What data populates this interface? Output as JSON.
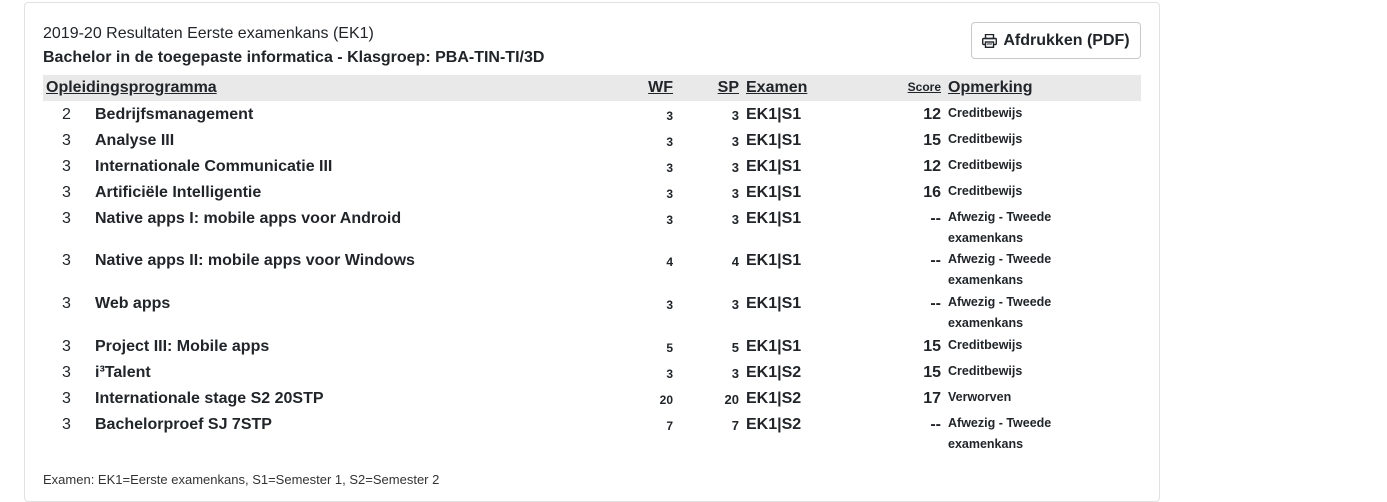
{
  "header": {
    "title": "2019-20 Resultaten Eerste examenkans (EK1)",
    "subtitle": "Bachelor in de toegepaste informatica - Klasgroep: PBA-TIN-TI/3D",
    "print_button": "Afdrukken (PDF)",
    "print_icon": "printer-icon"
  },
  "table": {
    "columns": {
      "program": "Opleidingsprogramma",
      "wf": "WF",
      "sp": "SP",
      "exam": "Examen",
      "score": "Score",
      "remark": "Opmerking"
    },
    "rows": [
      {
        "sem": "2",
        "name": "Bedrijfsmanagement",
        "wf": "3",
        "sp": "3",
        "exam": "EK1|S1",
        "score": "12",
        "remark": "Creditbewijs"
      },
      {
        "sem": "3",
        "name": "Analyse III",
        "wf": "3",
        "sp": "3",
        "exam": "EK1|S1",
        "score": "15",
        "remark": "Creditbewijs"
      },
      {
        "sem": "3",
        "name": "Internationale Communicatie III",
        "wf": "3",
        "sp": "3",
        "exam": "EK1|S1",
        "score": "12",
        "remark": "Creditbewijs"
      },
      {
        "sem": "3",
        "name": "Artificiële Intelligentie",
        "wf": "3",
        "sp": "3",
        "exam": "EK1|S1",
        "score": "16",
        "remark": "Creditbewijs"
      },
      {
        "sem": "3",
        "name": "Native apps I: mobile apps voor Android",
        "wf": "3",
        "sp": "3",
        "exam": "EK1|S1",
        "score": "--",
        "remark": "Afwezig - Tweede examenkans"
      },
      {
        "sem": "3",
        "name": "Native apps II: mobile apps voor Windows",
        "wf": "4",
        "sp": "4",
        "exam": "EK1|S1",
        "score": "--",
        "remark": "Afwezig - Tweede examenkans"
      },
      {
        "sem": "3",
        "name": "Web apps",
        "wf": "3",
        "sp": "3",
        "exam": "EK1|S1",
        "score": "--",
        "remark": "Afwezig - Tweede examenkans"
      },
      {
        "sem": "3",
        "name": "Project III: Mobile apps",
        "wf": "5",
        "sp": "5",
        "exam": "EK1|S1",
        "score": "15",
        "remark": "Creditbewijs"
      },
      {
        "sem": "3",
        "name": "i³Talent",
        "wf": "3",
        "sp": "3",
        "exam": "EK1|S2",
        "score": "15",
        "remark": "Creditbewijs"
      },
      {
        "sem": "3",
        "name": "Internationale stage S2 20STP",
        "wf": "20",
        "sp": "20",
        "exam": "EK1|S2",
        "score": "17",
        "remark": "Verworven"
      },
      {
        "sem": "3",
        "name": "Bachelorproef SJ 7STP",
        "wf": "7",
        "sp": "7",
        "exam": "EK1|S2",
        "score": "--",
        "remark": "Afwezig - Tweede examenkans"
      }
    ]
  },
  "footnote": "Examen: EK1=Eerste examenkans, S1=Semester 1, S2=Semester 2"
}
